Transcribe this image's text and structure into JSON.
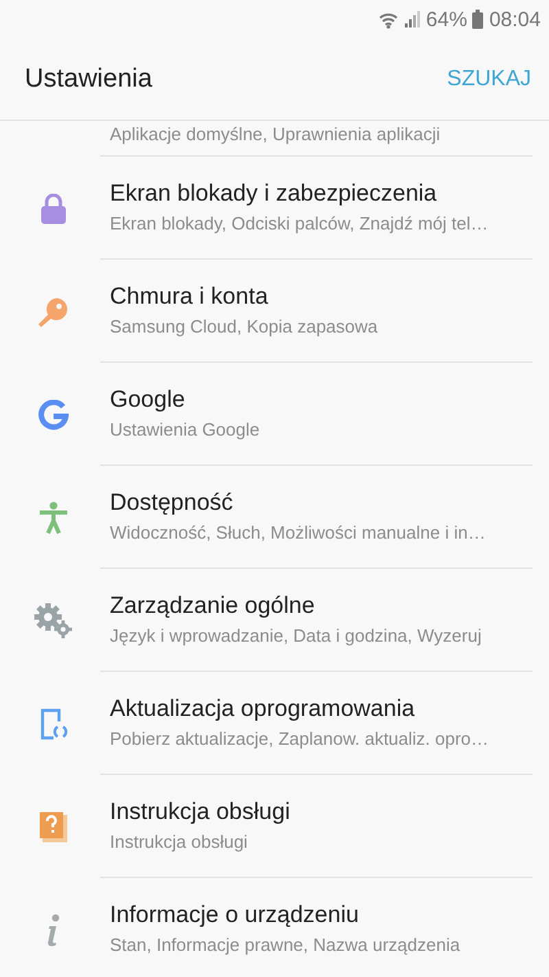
{
  "status_bar": {
    "battery_text": "64%",
    "time": "08:04"
  },
  "header": {
    "title": "Ustawienia",
    "action": "SZUKAJ"
  },
  "partial_item": {
    "subtitle": "Aplikacje domyślne, Uprawnienia aplikacji"
  },
  "items": [
    {
      "kind": "lock",
      "title": "Ekran blokady i zabezpieczenia",
      "subtitle": "Ekran blokady, Odciski palców, Znajdź mój tel…"
    },
    {
      "kind": "key",
      "title": "Chmura i konta",
      "subtitle": "Samsung Cloud, Kopia zapasowa"
    },
    {
      "kind": "google",
      "title": "Google",
      "subtitle": "Ustawienia Google"
    },
    {
      "kind": "accessibility",
      "title": "Dostępność",
      "subtitle": "Widoczność, Słuch, Możliwości manualne i in…"
    },
    {
      "kind": "gears",
      "title": "Zarządzanie ogólne",
      "subtitle": "Język i wprowadzanie, Data i godzina, Wyzeruj"
    },
    {
      "kind": "update",
      "title": "Aktualizacja oprogramowania",
      "subtitle": "Pobierz aktualizacje, Zaplanow. aktualiz. opro…"
    },
    {
      "kind": "manual",
      "title": "Instrukcja obsługi",
      "subtitle": "Instrukcja obsługi"
    },
    {
      "kind": "info",
      "title": "Informacje o urządzeniu",
      "subtitle": "Stan, Informacje prawne, Nazwa urządzenia"
    }
  ]
}
